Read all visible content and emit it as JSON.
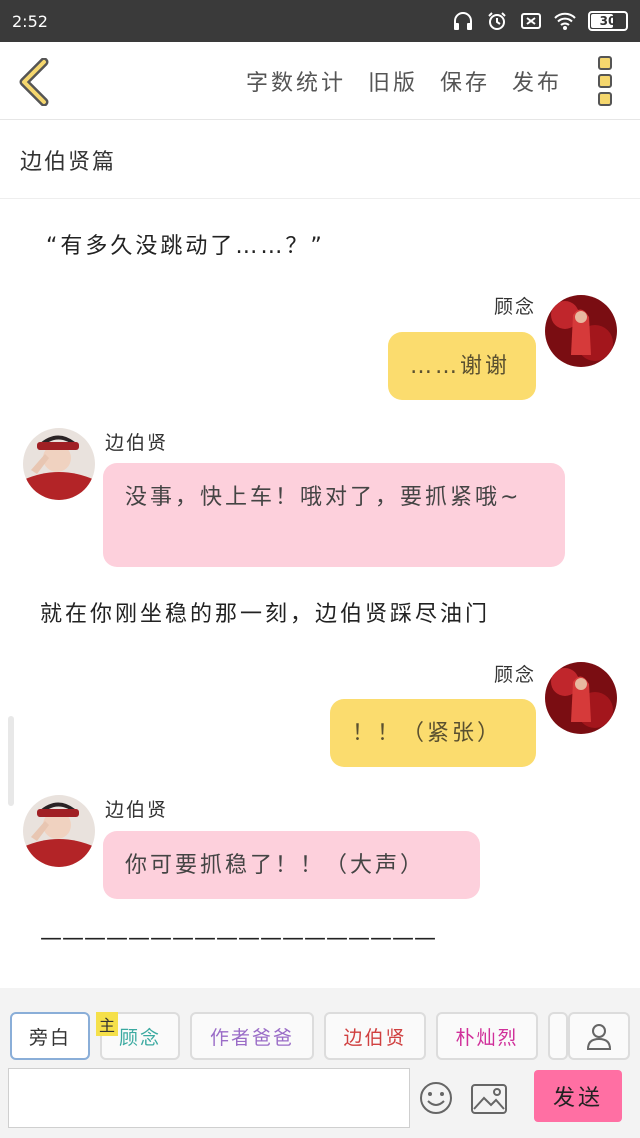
{
  "status": {
    "time": "2:52",
    "battery": "30"
  },
  "nav": {
    "actions": [
      "字数统计",
      "旧版",
      "保存",
      "发布"
    ]
  },
  "title": "边伯贤篇",
  "narration": [
    "“有多久没跳动了……？”",
    "就在你刚坐稳的那一刻，边伯贤踩尽油门",
    "——————————————————"
  ],
  "messages": [
    {
      "name": "顾念",
      "text": "……谢谢"
    },
    {
      "name": "边伯贤",
      "text": "没事，快上车！哦对了，要抓紧哦~"
    },
    {
      "name": "顾念",
      "text": "！！（紧张）"
    },
    {
      "name": "边伯贤",
      "text": "你可要抓稳了！！（大声）"
    }
  ],
  "roles": [
    {
      "label": "旁白",
      "color": "#444444"
    },
    {
      "label": "顾念",
      "color": "#3aa9a0"
    },
    {
      "label": "作者爸爸",
      "color": "#9a6cc7"
    },
    {
      "label": "边伯贤",
      "color": "#d04040"
    },
    {
      "label": "朴灿烈",
      "color": "#d0309a"
    }
  ],
  "role_badge": "主",
  "composer": {
    "send_label": "发送",
    "placeholder": ""
  }
}
